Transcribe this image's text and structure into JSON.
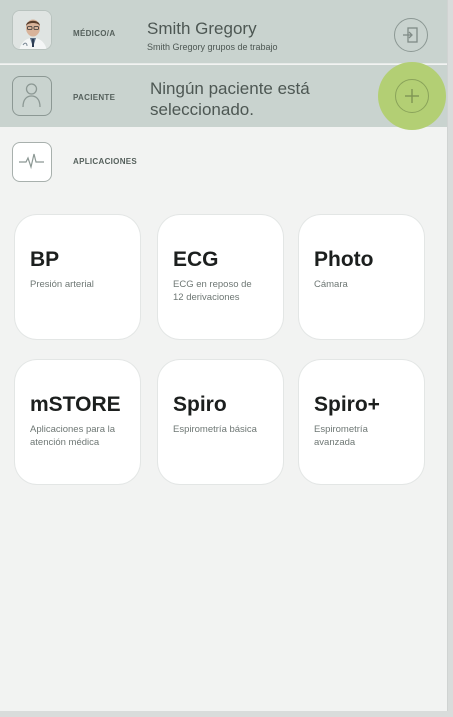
{
  "doctor": {
    "section_label": "MÉDICO/A",
    "name": "Smith Gregory",
    "subtitle": "Smith Gregory grupos de trabajo"
  },
  "patient": {
    "section_label": "PACIENTE",
    "message_line1": "Ningún paciente está",
    "message_line2": "seleccionado."
  },
  "apps": {
    "section_label": "APLICACIONES",
    "tiles": [
      {
        "title": "BP",
        "desc_line1": "Presión arterial",
        "desc_line2": ""
      },
      {
        "title": "ECG",
        "desc_line1": "ECG en reposo de",
        "desc_line2": "12 derivaciones"
      },
      {
        "title": "Photo",
        "desc_line1": "Cámara",
        "desc_line2": ""
      },
      {
        "title": "mSTORE",
        "desc_line1": "Aplicaciones para la",
        "desc_line2": "atención médica"
      },
      {
        "title": "Spiro",
        "desc_line1": "Espirometría básica",
        "desc_line2": ""
      },
      {
        "title": "Spiro+",
        "desc_line1": "Espirometría",
        "desc_line2": "avanzada"
      }
    ]
  },
  "colors": {
    "header_bg": "#c9d3cf",
    "accent_green": "#b3cf74",
    "tile_bg": "#ffffff"
  },
  "icons": {
    "doctor_avatar": "doctor-avatar",
    "logout": "logout-door-icon",
    "patient": "person-outline-icon",
    "add": "plus-icon",
    "apps": "pulse-wave-icon"
  }
}
